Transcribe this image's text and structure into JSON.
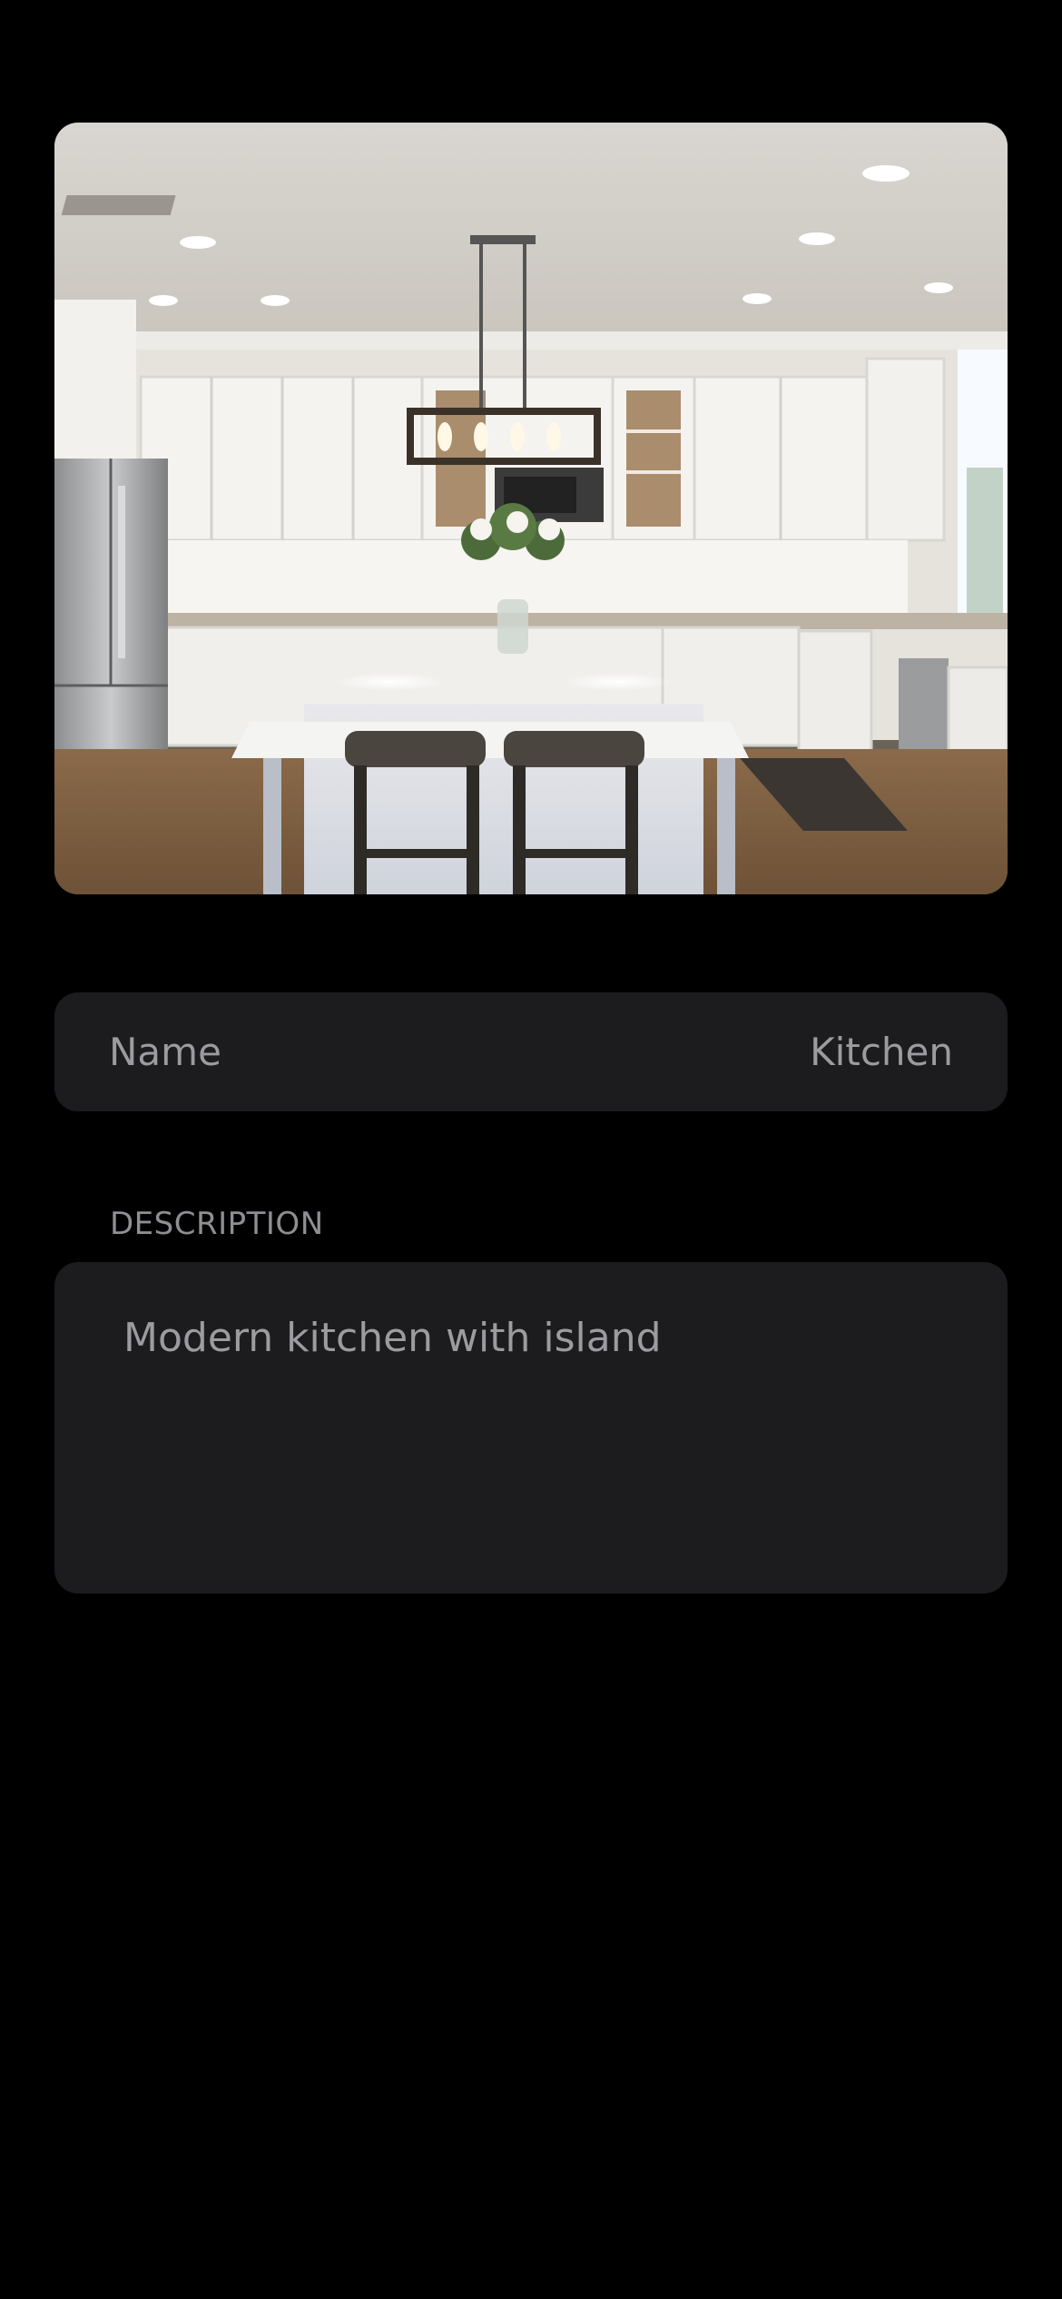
{
  "photo": {
    "alt_icon": "kitchen-photo"
  },
  "name_row": {
    "label": "Name",
    "value": "Kitchen"
  },
  "description": {
    "header": "DESCRIPTION",
    "text": "Modern kitchen with island"
  },
  "colors": {
    "background": "#000000",
    "field_background": "#1c1c1e",
    "secondary_text": "#9b9ba0",
    "section_header": "#8e8e93"
  }
}
